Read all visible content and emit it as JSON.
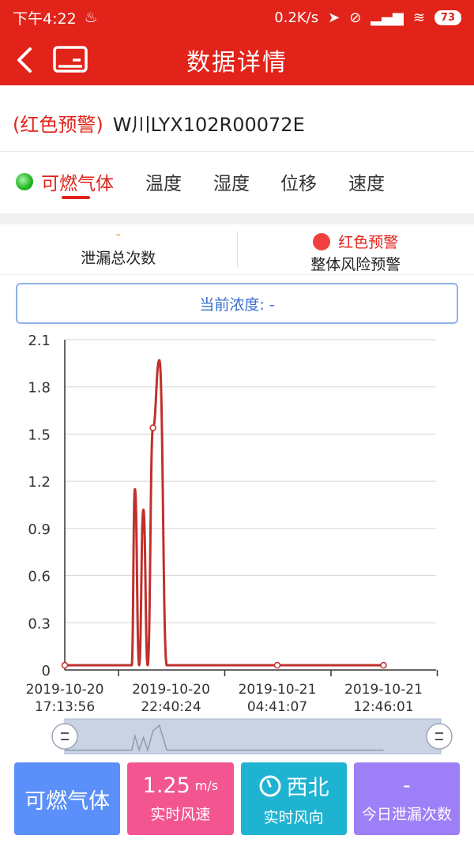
{
  "status": {
    "time": "下午4:22",
    "net_speed": "0.2K/s",
    "battery": "73"
  },
  "header": {
    "title": "数据详情"
  },
  "device": {
    "warning": "(红色预警)",
    "id": "W川LYX102R00072E"
  },
  "tabs": [
    {
      "label": "可燃气体",
      "active": true
    },
    {
      "label": "温度"
    },
    {
      "label": "湿度"
    },
    {
      "label": "位移"
    },
    {
      "label": "速度"
    }
  ],
  "stats": {
    "leak_total": {
      "value": "-",
      "label": "泄漏总次数"
    },
    "risk": {
      "value": "红色预警",
      "label": "整体风险预警"
    }
  },
  "concentration": {
    "text": "当前浓度: -"
  },
  "chart_data": {
    "type": "line",
    "x_ticks": [
      "2019-10-20\n17:13:56",
      "2019-10-20\n22:40:24",
      "2019-10-21\n04:41:07",
      "2019-10-21\n12:46:01"
    ],
    "y_ticks": [
      0,
      0.3,
      0.6,
      0.9,
      1.2,
      1.5,
      1.8,
      2.1
    ],
    "y_tick_labels": [
      "0",
      "0.3",
      "0.6",
      "0.9",
      "1.2",
      "1.5",
      "1.8",
      "2.1"
    ],
    "ylim": [
      0,
      2.1
    ],
    "series": [
      {
        "points": [
          [
            0,
            0.03
          ],
          [
            0.63,
            0.03
          ],
          [
            0.66,
            1.15
          ],
          [
            0.7,
            0.03
          ],
          [
            0.74,
            1.02
          ],
          [
            0.78,
            0.03
          ],
          [
            0.83,
            1.54
          ],
          [
            0.89,
            1.97
          ],
          [
            0.96,
            0.03
          ],
          [
            3.0,
            0.03
          ]
        ],
        "markers": [
          [
            0,
            0.03
          ],
          [
            0.83,
            1.54
          ],
          [
            2.0,
            0.03
          ],
          [
            3.0,
            0.03
          ]
        ],
        "color": "#c0302d"
      }
    ],
    "grid": true
  },
  "bottom": {
    "gas": {
      "label": "可燃气体",
      "color": "#5b8ff9"
    },
    "wind_speed": {
      "value": "1.25",
      "unit": "m/s",
      "label": "实时风速",
      "color": "#f2558f"
    },
    "wind_dir": {
      "value": "西北",
      "label": "实时风向",
      "color": "#1fb3d2"
    },
    "leak_today": {
      "value": "-",
      "label": "今日泄漏次数",
      "color": "#9d7ff7"
    }
  }
}
